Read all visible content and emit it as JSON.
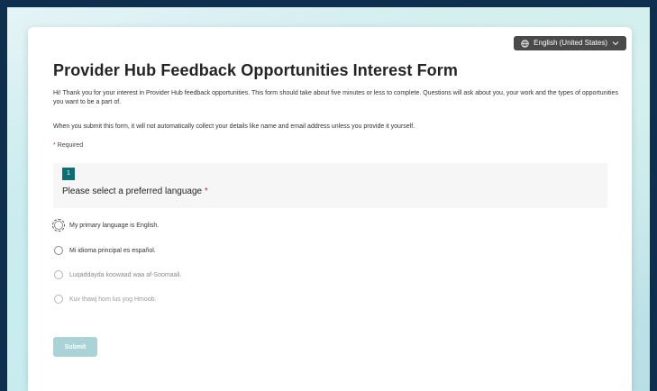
{
  "language_button": {
    "label": "English (United States)",
    "icon": "globe-icon",
    "chevron": "chevron-down-icon"
  },
  "form": {
    "title": "Provider Hub Feedback Opportunities Interest Form",
    "description": "Hi! Thank you for your interest in Provider Hub feedback opportunities. This form should take about five minutes or less to complete. Questions will ask about you, your work and the types of opportunities you want to be a part of.",
    "privacy_note": "When you submit this form, it will not automatically collect your details like name and email address unless you provide it yourself.",
    "required_star": "*",
    "required_label": "Required"
  },
  "question": {
    "number": "1",
    "text": "Please select a preferred language",
    "required_star": "*",
    "options": [
      "My primary language is English.",
      "Mi idioma principal es español.",
      "Luqaddayda koowaad waa af-Soomaali.",
      "Kuv thawj hom lus yog Hmoob."
    ]
  },
  "submit": {
    "label": "Submit"
  },
  "colors": {
    "accent": "#0f6e73",
    "required": "#c4314b",
    "submit_disabled": "#a9d3d6",
    "language_button_bg": "#4a4a4a"
  }
}
